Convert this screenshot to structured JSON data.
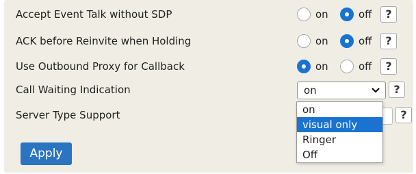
{
  "settings": [
    {
      "label": "Accept Event Talk without SDP",
      "options": [
        "on",
        "off"
      ],
      "selected": "off"
    },
    {
      "label": "ACK before Reinvite when Holding",
      "options": [
        "on",
        "off"
      ],
      "selected": "off"
    },
    {
      "label": "Use Outbound Proxy for Callback",
      "options": [
        "on",
        "off"
      ],
      "selected": "on"
    }
  ],
  "call_waiting": {
    "label": "Call Waiting Indication",
    "value": "on"
  },
  "server_type": {
    "label": "Server Type Support"
  },
  "dropdown": {
    "options": [
      "on",
      "visual only",
      "Ringer",
      "Off"
    ],
    "highlighted": "visual only"
  },
  "help_label": "?",
  "apply_label": "Apply",
  "colors": {
    "panel": "#f0eee4",
    "accent": "#1a73d1",
    "apply": "#2a74c2"
  },
  "icons": {
    "help": "question-mark-icon",
    "select_arrow": "chevron-down-icon"
  }
}
